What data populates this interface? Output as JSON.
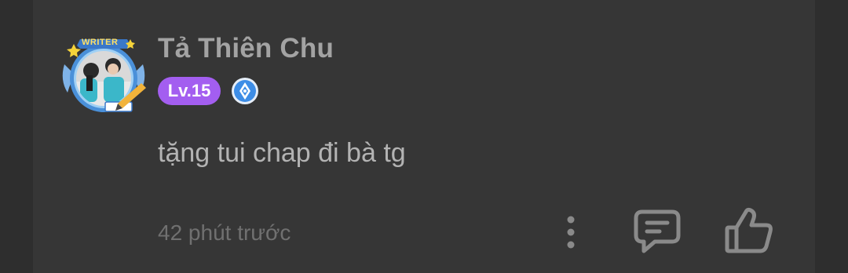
{
  "comment": {
    "username": "Tả Thiên Chu",
    "level": "Lv.15",
    "text": "tặng tui chap đi bà tg",
    "timestamp": "42 phút trước",
    "avatar_frame_label": "WRITER"
  },
  "colors": {
    "background": "#333333",
    "card": "#363636",
    "level_badge": "#a35ef0",
    "icon": "#8a8a8a",
    "pen_badge": "#3d8de6"
  },
  "icons": {
    "more": "more-vertical-icon",
    "reply": "reply-comment-icon",
    "like": "thumbs-up-icon",
    "badge": "writer-pen-badge-icon"
  }
}
